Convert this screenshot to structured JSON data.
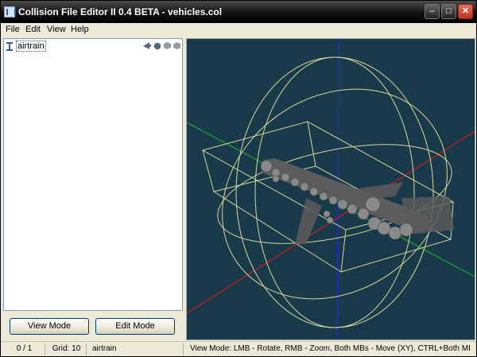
{
  "window": {
    "title": "Collision File Editor II 0.4 BETA - vehicles.col"
  },
  "title_buttons": {
    "minimize": "–",
    "maximize": "□",
    "close": "✕"
  },
  "menu": {
    "file": "File",
    "edit": "Edit",
    "view": "View",
    "help": "Help"
  },
  "tree": {
    "items": [
      {
        "label": "airtrain"
      }
    ]
  },
  "buttons": {
    "view_mode": "View Mode",
    "edit_mode": "Edit Mode"
  },
  "status": {
    "count": "0 / 1",
    "grid": "Grid: 10",
    "model": "airtrain",
    "hint": "View Mode: LMB - Rotate, RMB - Zoom, Both MBs - Move (XY), CTRL+Both MBs"
  },
  "colors": {
    "viewport_bg": "#193a4b",
    "wireframe": "#d8d89a",
    "axis_x": "#c02020",
    "axis_y": "#20a030",
    "axis_z": "#2030c0",
    "mesh": "#5c5c5c"
  },
  "icons": [
    "app-icon",
    "tree-node-icon",
    "prev-icon",
    "sphere-icon",
    "box-icon",
    "mesh-icon"
  ]
}
